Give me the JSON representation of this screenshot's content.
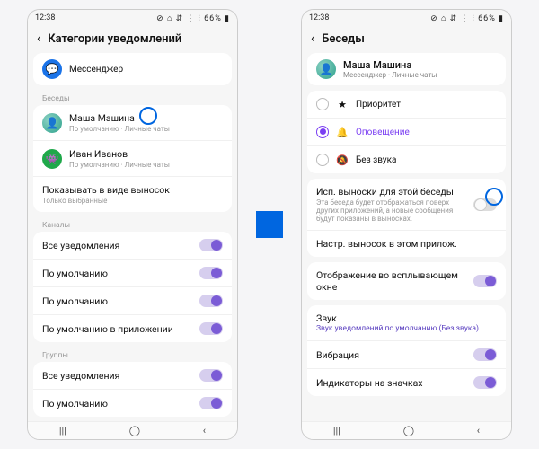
{
  "status": {
    "time": "12:38",
    "icons_left": "▣ ⬚ ✎",
    "icons_right": "⊘ ⌂ ⇵ ⋮ ⫶ 66% ▮"
  },
  "left": {
    "title": "Категории уведомлений",
    "app": {
      "name": "Мессенджер"
    },
    "sec_conv": "Беседы",
    "conv": [
      {
        "name": "Маша Машина",
        "sub": "По умолчанию · Личные чаты"
      },
      {
        "name": "Иван Иванов",
        "sub": "По умолчанию · Личные чаты"
      }
    ],
    "bubble": {
      "t": "Показывать в виде выносок",
      "s": "Только выбранные"
    },
    "sec_ch": "Каналы",
    "ch": [
      "Все уведомления",
      "По умолчанию",
      "По умолчанию",
      "По умолчанию в приложении"
    ],
    "sec_gr": "Группы",
    "gr": [
      "Все уведомления",
      "По умолчанию"
    ]
  },
  "right": {
    "title": "Беседы",
    "contact": {
      "name": "Маша Машина",
      "sub": "Мессенджер · Личные чаты"
    },
    "opts": [
      {
        "label": "Приоритет",
        "icon": "★"
      },
      {
        "label": "Оповещение",
        "icon": "🔔",
        "selected": true
      },
      {
        "label": "Без звука",
        "icon": "🔕"
      }
    ],
    "bubble": {
      "t": "Исп. выноски для этой беседы",
      "s": "Эта беседа будет отображаться поверх других приложений, а новые сообщения будут показаны в выносках."
    },
    "settings_link": "Настр. выносок в этом прилож.",
    "popup": "Отображение во всплывающем окне",
    "sound": {
      "t": "Звук",
      "s": "Звук уведомлений по умолчанию (Без звука)"
    },
    "vibr": "Вибрация",
    "badge": "Индикаторы на значках"
  }
}
